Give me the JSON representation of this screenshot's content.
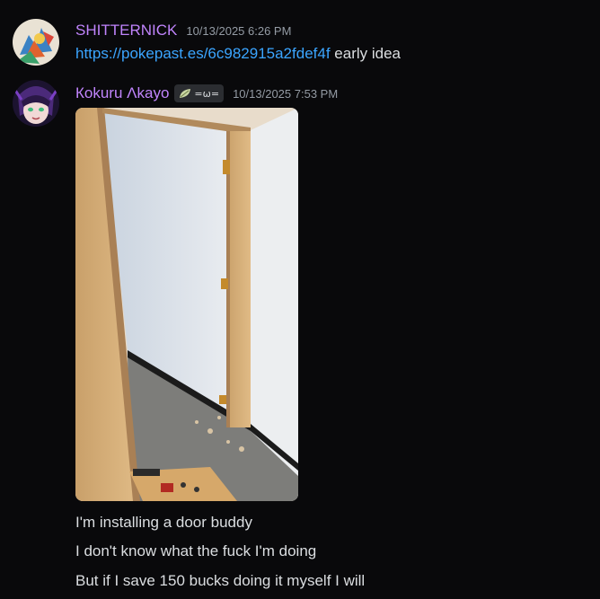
{
  "messages": [
    {
      "username": "SHITTERNICK",
      "timestamp": "10/13/2025 6:26 PM",
      "link": "https://pokepast.es/6c982915a2fdef4f",
      "text": "early idea"
    },
    {
      "username": "Кokuru Λkayo",
      "tag_text": "=ω=",
      "tag_icon": "leaf-icon",
      "timestamp": "10/13/2025 7:53 PM",
      "attachment": "image-attachment",
      "lines": [
        "I'm installing a door buddy",
        "I don't know what the fuck I'm doing",
        "But if I save 150 bucks doing it myself I will"
      ]
    }
  ],
  "colors": {
    "background": "#09090b",
    "username": "#c084fc",
    "link": "#3ba5ff",
    "text": "#dbdee1",
    "timestamp": "#949ba4"
  }
}
